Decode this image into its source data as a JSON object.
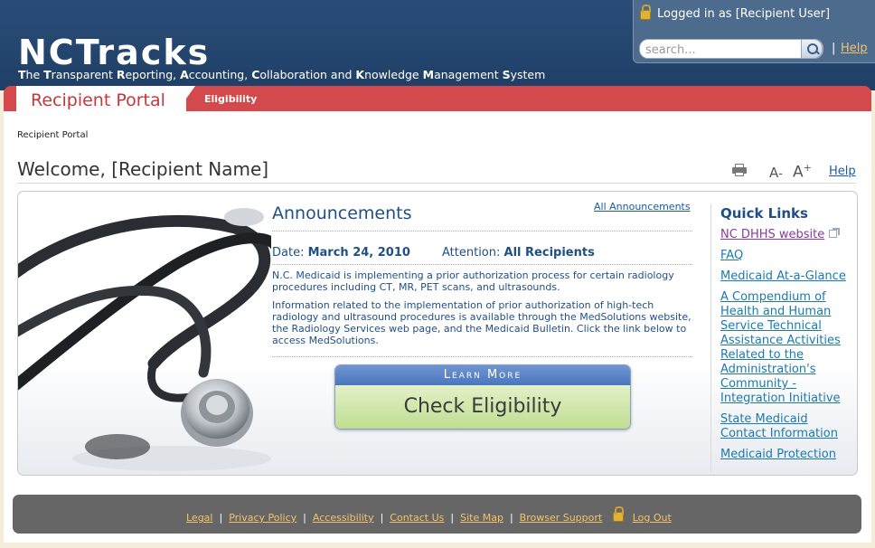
{
  "header": {
    "logo": "NCTracks",
    "tagline_parts": [
      {
        "b": "T",
        "t": "he "
      },
      {
        "b": "T",
        "t": "ransparent "
      },
      {
        "b": "R",
        "t": "eporting, "
      },
      {
        "b": "A",
        "t": "ccounting, "
      },
      {
        "b": "C",
        "t": "ollaboration and "
      },
      {
        "b": "K",
        "t": "nowledge "
      },
      {
        "b": "M",
        "t": "anagement "
      },
      {
        "b": "S",
        "t": "ystem"
      }
    ],
    "login_status": "Logged in as [Recipient User]",
    "search_placeholder": "search...",
    "separator": "|",
    "help_label": "Help"
  },
  "nav": {
    "portal_title": "Recipient Portal",
    "eligibility_tab": "Eligibility"
  },
  "breadcrumb": "Recipient Portal",
  "welcome": "Welcome, [Recipient Name]",
  "tools": {
    "font_decrease": "A",
    "font_increase": "A",
    "help_label": "Help"
  },
  "announcements": {
    "title": "Announcements",
    "all_link": "All Announcements",
    "date_label": "Date:",
    "date_value": "March 24, 2010",
    "attention_label": "Attention:",
    "attention_value": "All Recipients",
    "para1": "N.C. Medicaid is implementing a prior authorization process for certain radiology procedures including CT, MR, PET scans, and ultrasounds.",
    "para2": "Information related to the implementation of prior authorization of high-tech radiology and ultrasound procedures is available through the MedSolutions website, the Radiology Services web page, and the Medicaid Bulletin. Click the link below to access MedSolutions."
  },
  "learn_more": {
    "top": "Learn More",
    "bottom": "Check Eligibility"
  },
  "quick_links": {
    "title": "Quick Links",
    "items": [
      "NC DHHS website",
      "FAQ",
      "Medicaid At-a-Glance",
      "A Compendium of Health and Human Service Technical Assistance Activities Related to the Administration's Community - Integration Initiative",
      "State Medicaid Contact Information",
      "Medicaid Protection"
    ]
  },
  "footer": {
    "links": [
      "Legal",
      "Privacy Policy",
      "Accessibility",
      "Contact Us",
      "Site Map",
      "Browser Support"
    ],
    "logout": "Log Out",
    "separator": "|"
  },
  "colors": {
    "header_blue": "#1f3f66",
    "accent_red": "#d44a4c",
    "link_blue": "#1a7ab0",
    "heading_blue": "#1f4f86",
    "footer_gray": "#666666"
  }
}
